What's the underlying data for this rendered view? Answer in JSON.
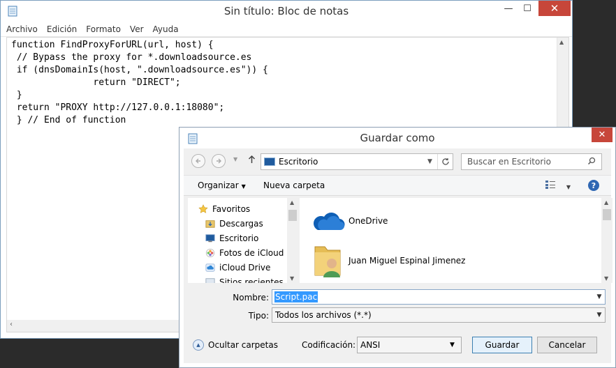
{
  "notepad": {
    "title": "Sin título: Bloc de notas",
    "controls": {
      "minimize": "—",
      "maximize": "☐",
      "close": "✕"
    },
    "menu": [
      "Archivo",
      "Edición",
      "Formato",
      "Ver",
      "Ayuda"
    ],
    "lines": [
      "function FindProxyForURL(url, host) {",
      " // Bypass the proxy for *.downloadsource.es",
      " if (dnsDomainIs(host, \".downloadsource.es\")) {",
      "               return \"DIRECT\";",
      " }",
      " return \"PROXY http://127.0.0.1:18080\";",
      " } // End of function"
    ]
  },
  "dialog": {
    "title": "Guardar como",
    "close": "✕",
    "address": "Escritorio",
    "search_placeholder": "Buscar en Escritorio",
    "toolbar": {
      "organize": "Organizar",
      "new_folder": "Nueva carpeta"
    },
    "nav_items": [
      "Favoritos",
      "Descargas",
      "Escritorio",
      "Fotos de iCloud",
      "iCloud Drive",
      "Sitios recientes"
    ],
    "content_items": [
      "OneDrive",
      "Juan Miguel Espinal Jimenez"
    ],
    "labels": {
      "name": "Nombre:",
      "type": "Tipo:",
      "encoding": "Codificación:"
    },
    "filename": "Script.pac",
    "filetype": "Todos los archivos  (*.*)",
    "encoding": "ANSI",
    "hide_folders": "Ocultar carpetas",
    "save": "Guardar",
    "cancel": "Cancelar"
  }
}
